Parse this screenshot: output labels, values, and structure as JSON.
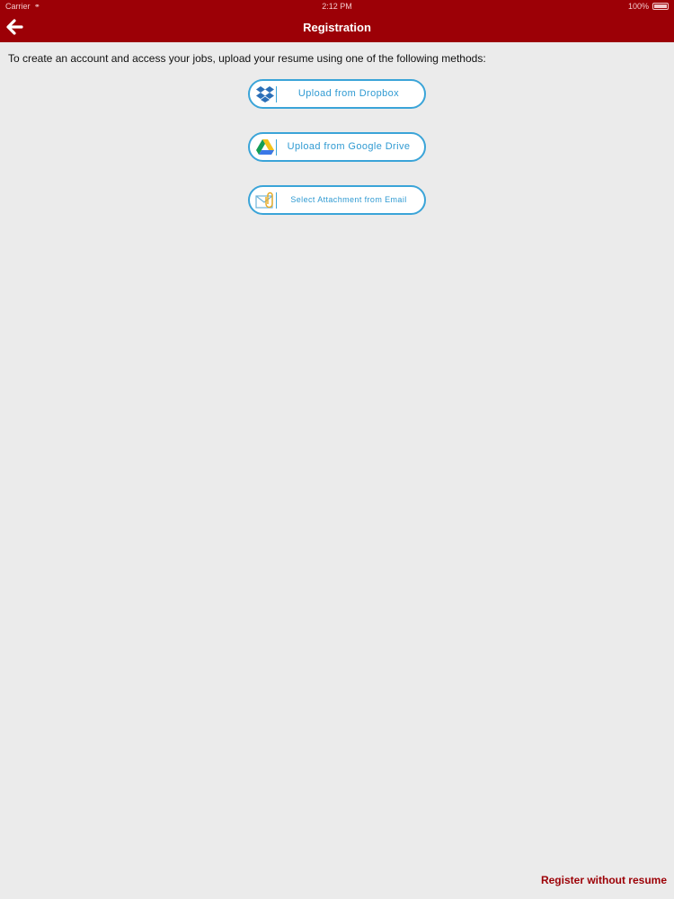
{
  "status_bar": {
    "carrier": "Carrier",
    "time": "2:12 PM",
    "battery": "100%"
  },
  "nav": {
    "title": "Registration",
    "back_icon": "back-arrow-icon"
  },
  "instructions": "To create an account and access your jobs, upload your resume using one of the following methods:",
  "upload_options": [
    {
      "label": "Upload from Dropbox",
      "icon": "dropbox-icon"
    },
    {
      "label": "Upload from Google Drive",
      "icon": "google-drive-icon"
    },
    {
      "label": "Select Attachment from Email",
      "icon": "email-attachment-icon"
    }
  ],
  "register_without_resume": "Register without resume",
  "colors": {
    "header": "#9c0006",
    "button_border": "#3aa4d8",
    "button_text": "#2f9ad2",
    "link": "#9c0006",
    "background": "#ebebeb"
  }
}
